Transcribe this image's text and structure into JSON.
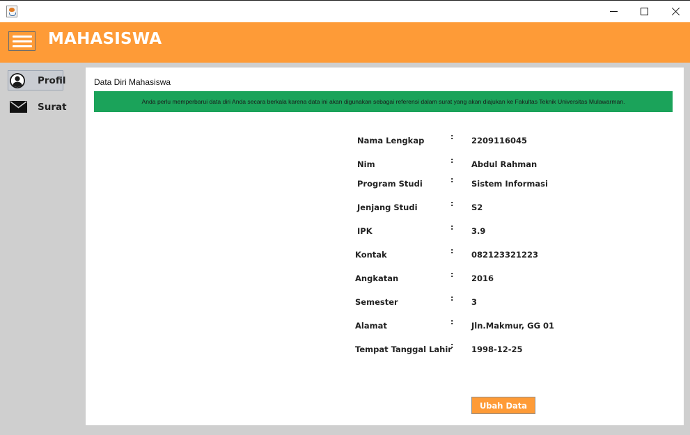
{
  "header": {
    "title": "MAHASISWA",
    "color": "#fe9b37"
  },
  "sidebar": {
    "items": [
      {
        "label": "Profil",
        "icon": "user-icon",
        "active": true
      },
      {
        "label": "Surat",
        "icon": "mail-icon",
        "active": false
      }
    ]
  },
  "panel": {
    "title": "Data Diri Mahasiswa",
    "notice": "Anda perlu memperbarui data diri Anda secara berkala karena data ini akan digunakan sebagai referensi dalam surat yang akan diajukan ke Fakultas Teknik Universitas Mulawarman.",
    "notice_color": "#1ba35a",
    "fields": [
      {
        "label": "Nama Lengkap",
        "value": "2209116045"
      },
      {
        "label": "Nim",
        "value": "Abdul Rahman"
      },
      {
        "label": "Program Studi",
        "value": "Sistem Informasi"
      },
      {
        "label": "Jenjang Studi",
        "value": "S2"
      },
      {
        "label": "IPK",
        "value": "3.9"
      },
      {
        "label": "Kontak",
        "value": "082123321223"
      },
      {
        "label": "Angkatan",
        "value": "2016"
      },
      {
        "label": "Semester",
        "value": "3"
      },
      {
        "label": "Alamat",
        "value": "Jln.Makmur, GG 01"
      },
      {
        "label": "Tempat Tanggal Lahir",
        "value": "1998-12-25"
      }
    ],
    "separator": ":",
    "edit_button": "Ubah Data"
  }
}
